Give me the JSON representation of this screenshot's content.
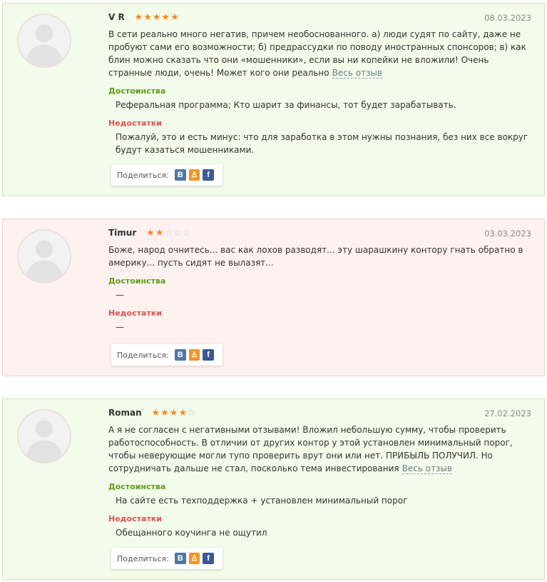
{
  "share_label": "Поделиться:",
  "more_label": "Весь отзыв",
  "advantages_label": "Достоинства",
  "disadvantages_label": "Недостатки",
  "social": {
    "vk": "B",
    "ok": "ok",
    "fb": "f"
  },
  "reviews": [
    {
      "author": "V R",
      "rating": 5,
      "date": "08.03.2023",
      "text": "В сети реально много негатив, причем необоснованного. а) люди судят по сайту, даже не пробуют сами его возможности; б) предрассудки по поводу иностранных спонсоров; в) как блин можно сказать что они «мошенники», если вы ни копейки не вложили! Очень странные люди, очень! Может кого они реально",
      "advantages": "Реферальная программа; Кто шарит за финансы, тот будет зарабатывать.",
      "disadvantages": "Пожалуй, это и есть минус: что для заработка в этом нужны познания, без них все вокруг будут казаться мошенниками.",
      "tone": "positive"
    },
    {
      "author": "Timur",
      "rating": 2,
      "date": "03.03.2023",
      "text": "Боже, народ очнитесь... вас как лохов разводят... эту шарашкину контору гнать обратно в америку... пусть сидят не вылазят...",
      "advantages": "—",
      "disadvantages": "—",
      "tone": "negative"
    },
    {
      "author": "Roman",
      "rating": 4,
      "date": "27.02.2023",
      "text": "А я не согласен с негативными отзывами! Вложил небольшую сумму, чтобы проверить работоспособность. В отличии от других контор у этой установлен минимальный порог, чтобы неверующие могли тупо проверить врут они или нет. ПРИБЫЛЬ ПОЛУЧИЛ. Но сотрудничать дальше не стал, посколько тема инвестирования",
      "advantages": "На сайте есть техподдержка + установлен минимальный порог",
      "disadvantages": "Обещанного коучинга не ощутил",
      "tone": "positive"
    }
  ]
}
